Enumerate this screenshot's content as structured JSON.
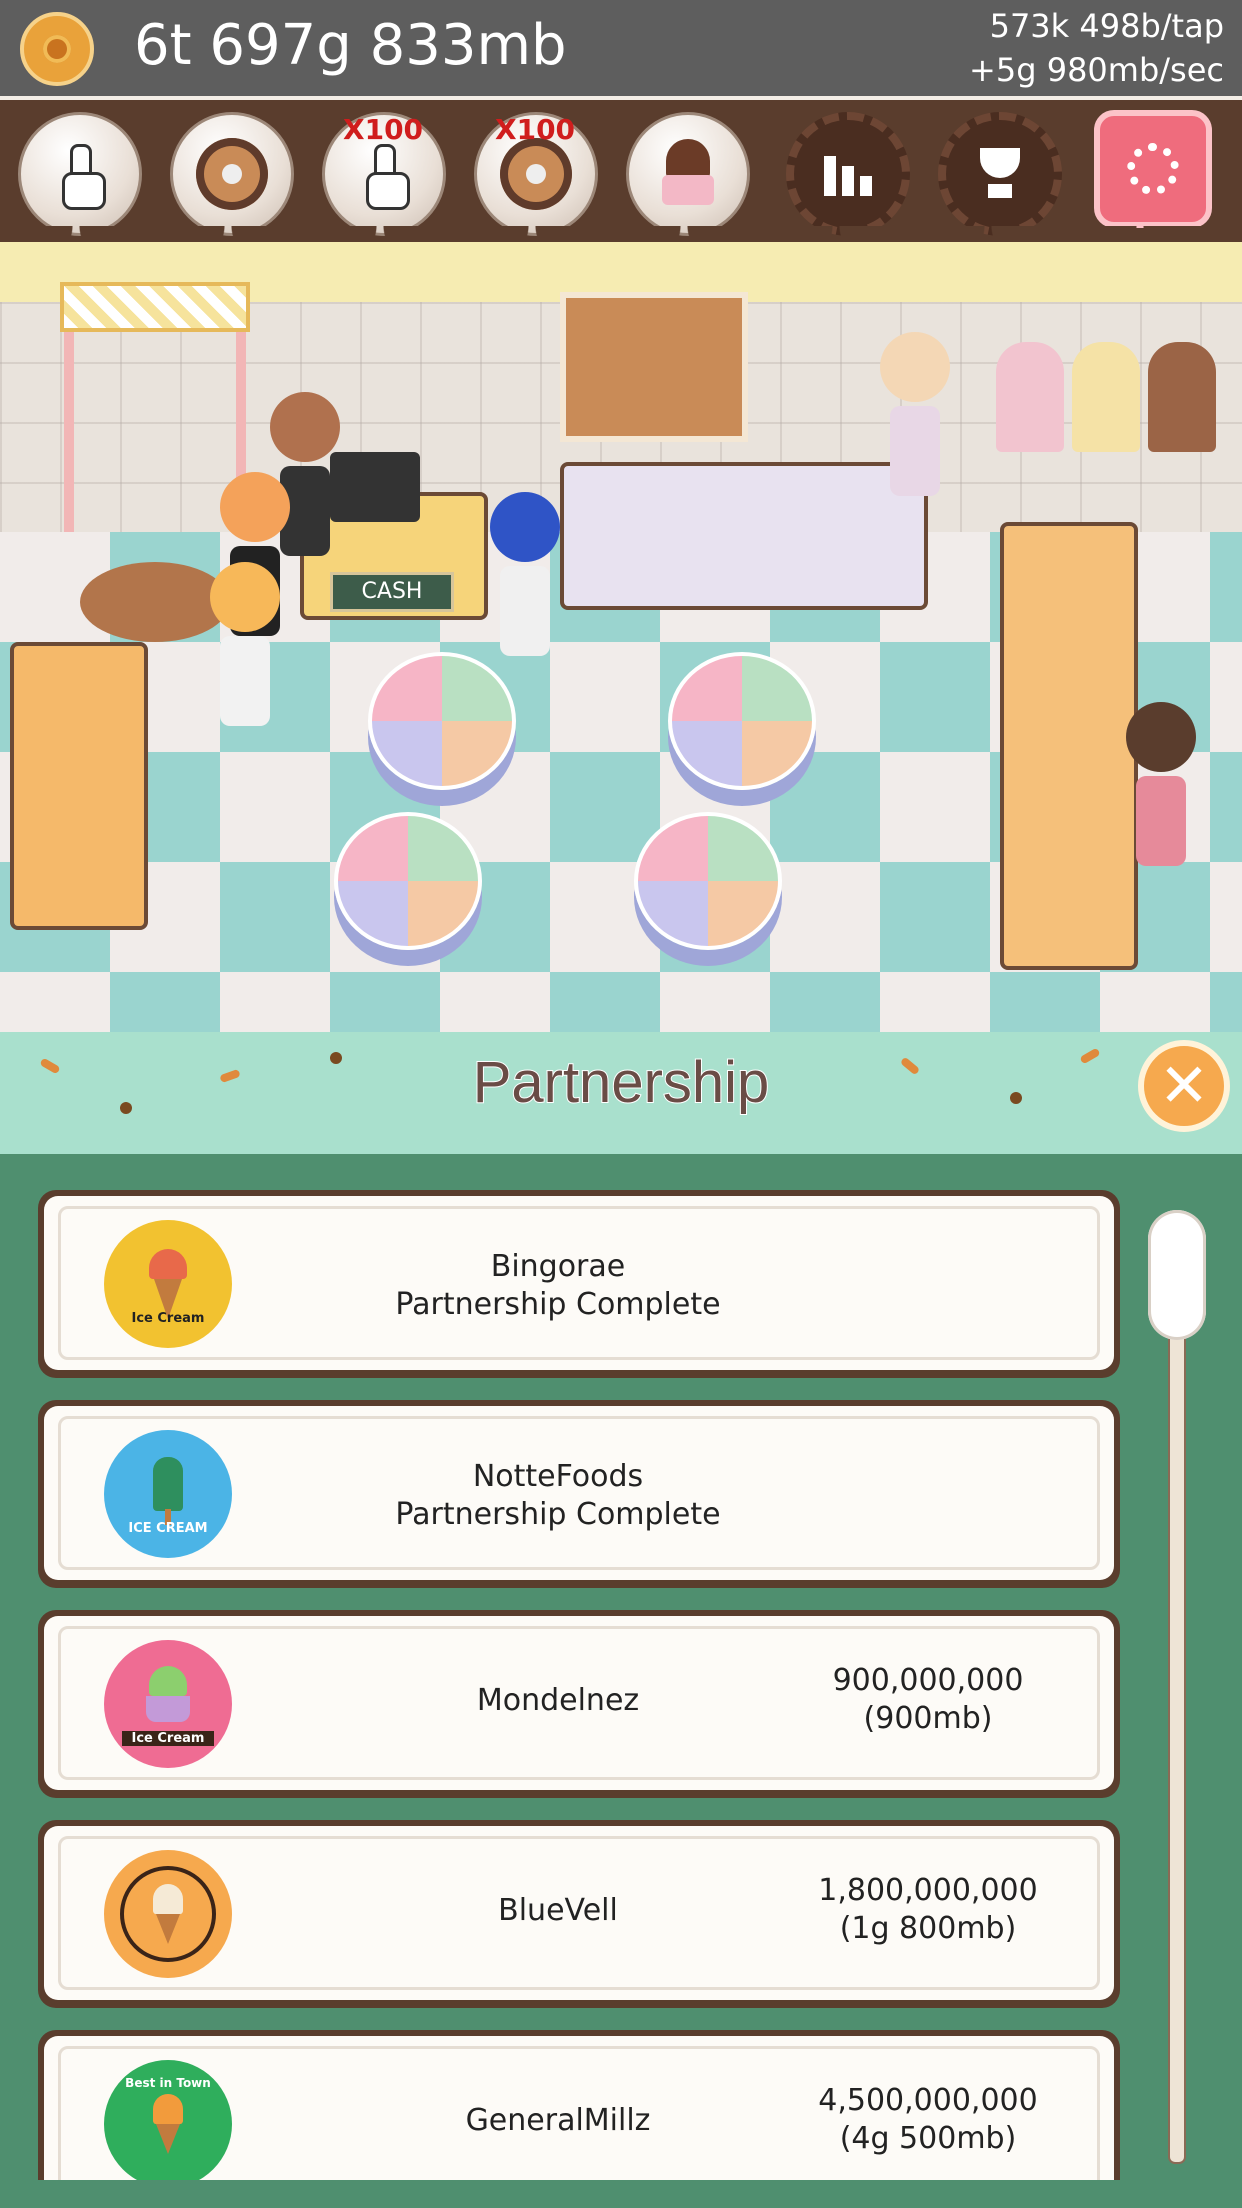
{
  "header": {
    "money": "6t 697g 833mb",
    "per_tap": "573k 498b/tap",
    "per_sec": "+5g 980mb/sec"
  },
  "toolbar": {
    "x100_label_1": "X100",
    "x100_label_2": "X100",
    "settings_color": "#ef6c7d"
  },
  "scene": {
    "cash_sign": "CASH"
  },
  "panel": {
    "title": "Partnership",
    "close_label": "✕",
    "items": [
      {
        "name": "Bingorae",
        "status": "Partnership Complete",
        "logo": "premium-quality-ice-cream-logo",
        "logo_text": "Ice Cream",
        "color": "#f2c230"
      },
      {
        "name": "NotteFoods",
        "status": "Partnership Complete",
        "logo": "popsicle-ice-cream-logo",
        "logo_text": "ICE CREAM",
        "color": "#4bb4e6"
      },
      {
        "name": "Mondelnez",
        "price": "900,000,000",
        "price_short": "(900mb)",
        "logo": "sundae-ice-cream-logo",
        "logo_text": "Ice Cream",
        "color": "#ef6c93"
      },
      {
        "name": "BlueVell",
        "price": "1,800,000,000",
        "price_short": "(1g 800mb)",
        "logo": "soft-serve-cone-logo",
        "color": "#f6a94e"
      },
      {
        "name": "GeneralMillz",
        "price": "4,500,000,000",
        "price_short": "(4g 500mb)",
        "logo": "best-in-town-cone-logo",
        "logo_text": "Best in Town",
        "color": "#2fae5c"
      }
    ]
  }
}
